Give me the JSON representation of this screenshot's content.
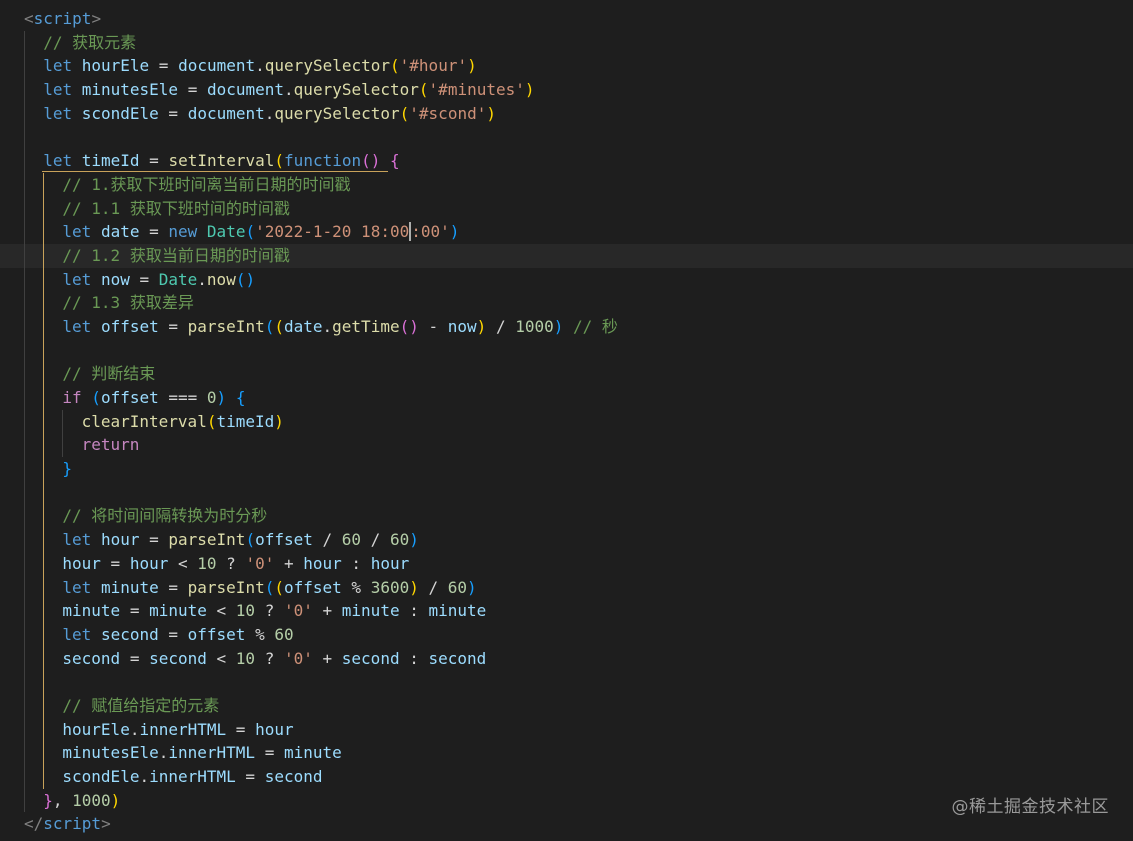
{
  "editor": {
    "theme_colors": {
      "background": "#1e1e1e",
      "comment": "#6a9955",
      "keyword": "#569cd6",
      "variable": "#9cdcfe",
      "function": "#dcdcaa",
      "string": "#ce9178",
      "number": "#b5cea8",
      "class": "#4ec9b0",
      "control": "#c586c0"
    },
    "cursor_line": 10,
    "lines": [
      {
        "indent": 0,
        "tokens": [
          [
            "tag",
            "<"
          ],
          [
            "tagname",
            "script"
          ],
          [
            "tag",
            ">"
          ]
        ]
      },
      {
        "indent": 1,
        "tokens": [
          [
            "comment",
            "// 获取元素"
          ]
        ]
      },
      {
        "indent": 1,
        "tokens": [
          [
            "kw",
            "let"
          ],
          [
            "plain",
            " "
          ],
          [
            "var",
            "hourEle"
          ],
          [
            "op",
            " = "
          ],
          [
            "var",
            "document"
          ],
          [
            "punc",
            "."
          ],
          [
            "fn",
            "querySelector"
          ],
          [
            "b1",
            "("
          ],
          [
            "str",
            "'#hour'"
          ],
          [
            "b1",
            ")"
          ]
        ]
      },
      {
        "indent": 1,
        "tokens": [
          [
            "kw",
            "let"
          ],
          [
            "plain",
            " "
          ],
          [
            "var",
            "minutesEle"
          ],
          [
            "op",
            " = "
          ],
          [
            "var",
            "document"
          ],
          [
            "punc",
            "."
          ],
          [
            "fn",
            "querySelector"
          ],
          [
            "b1",
            "("
          ],
          [
            "str",
            "'#minutes'"
          ],
          [
            "b1",
            ")"
          ]
        ]
      },
      {
        "indent": 1,
        "tokens": [
          [
            "kw",
            "let"
          ],
          [
            "plain",
            " "
          ],
          [
            "var",
            "scondEle"
          ],
          [
            "op",
            " = "
          ],
          [
            "var",
            "document"
          ],
          [
            "punc",
            "."
          ],
          [
            "fn",
            "querySelector"
          ],
          [
            "b1",
            "("
          ],
          [
            "str",
            "'#scond'"
          ],
          [
            "b1",
            ")"
          ]
        ]
      },
      {
        "indent": 1,
        "tokens": []
      },
      {
        "indent": 1,
        "tokens": [
          [
            "kw",
            "let"
          ],
          [
            "plain",
            " "
          ],
          [
            "var",
            "timeId"
          ],
          [
            "op",
            " = "
          ],
          [
            "fn",
            "setInterval"
          ],
          [
            "b1",
            "("
          ],
          [
            "kw",
            "function"
          ],
          [
            "b2",
            "()"
          ],
          [
            "plain",
            " "
          ],
          [
            "b2",
            "{"
          ]
        ]
      },
      {
        "indent": 2,
        "tokens": [
          [
            "comment",
            "// 1.获取下班时间离当前日期的时间戳"
          ]
        ]
      },
      {
        "indent": 2,
        "tokens": [
          [
            "comment",
            "// 1.1 获取下班时间的时间戳"
          ]
        ]
      },
      {
        "indent": 2,
        "tokens": [
          [
            "kw",
            "let"
          ],
          [
            "plain",
            " "
          ],
          [
            "var",
            "date"
          ],
          [
            "op",
            " = "
          ],
          [
            "kw",
            "new"
          ],
          [
            "plain",
            " "
          ],
          [
            "cls",
            "Date"
          ],
          [
            "b3",
            "("
          ],
          [
            "str",
            "'2022-1-20 18:00"
          ],
          [
            "caret",
            ""
          ],
          [
            "str",
            ":00'"
          ],
          [
            "b3",
            ")"
          ]
        ]
      },
      {
        "indent": 2,
        "tokens": [
          [
            "comment",
            "// 1.2 获取当前日期的时间戳"
          ]
        ]
      },
      {
        "indent": 2,
        "tokens": [
          [
            "kw",
            "let"
          ],
          [
            "plain",
            " "
          ],
          [
            "var",
            "now"
          ],
          [
            "op",
            " = "
          ],
          [
            "cls",
            "Date"
          ],
          [
            "punc",
            "."
          ],
          [
            "fn",
            "now"
          ],
          [
            "b3",
            "()"
          ]
        ]
      },
      {
        "indent": 2,
        "tokens": [
          [
            "comment",
            "// 1.3 获取差异"
          ]
        ]
      },
      {
        "indent": 2,
        "tokens": [
          [
            "kw",
            "let"
          ],
          [
            "plain",
            " "
          ],
          [
            "var",
            "offset"
          ],
          [
            "op",
            " = "
          ],
          [
            "fn",
            "parseInt"
          ],
          [
            "b3",
            "("
          ],
          [
            "b1",
            "("
          ],
          [
            "var",
            "date"
          ],
          [
            "punc",
            "."
          ],
          [
            "fn",
            "getTime"
          ],
          [
            "b2",
            "()"
          ],
          [
            "op",
            " - "
          ],
          [
            "var",
            "now"
          ],
          [
            "b1",
            ")"
          ],
          [
            "op",
            " / "
          ],
          [
            "num",
            "1000"
          ],
          [
            "b3",
            ")"
          ],
          [
            "plain",
            " "
          ],
          [
            "comment",
            "// 秒"
          ]
        ]
      },
      {
        "indent": 2,
        "tokens": []
      },
      {
        "indent": 2,
        "tokens": [
          [
            "comment",
            "// 判断结束"
          ]
        ]
      },
      {
        "indent": 2,
        "tokens": [
          [
            "ctl",
            "if"
          ],
          [
            "plain",
            " "
          ],
          [
            "b3",
            "("
          ],
          [
            "var",
            "offset"
          ],
          [
            "op",
            " === "
          ],
          [
            "num",
            "0"
          ],
          [
            "b3",
            ")"
          ],
          [
            "plain",
            " "
          ],
          [
            "b3",
            "{"
          ]
        ]
      },
      {
        "indent": 3,
        "tokens": [
          [
            "fn",
            "clearInterval"
          ],
          [
            "b1",
            "("
          ],
          [
            "var",
            "timeId"
          ],
          [
            "b1",
            ")"
          ]
        ]
      },
      {
        "indent": 3,
        "tokens": [
          [
            "ctl",
            "return"
          ]
        ]
      },
      {
        "indent": 2,
        "tokens": [
          [
            "b3",
            "}"
          ]
        ]
      },
      {
        "indent": 2,
        "tokens": []
      },
      {
        "indent": 2,
        "tokens": [
          [
            "comment",
            "// 将时间间隔转换为时分秒"
          ]
        ]
      },
      {
        "indent": 2,
        "tokens": [
          [
            "kw",
            "let"
          ],
          [
            "plain",
            " "
          ],
          [
            "var",
            "hour"
          ],
          [
            "op",
            " = "
          ],
          [
            "fn",
            "parseInt"
          ],
          [
            "b3",
            "("
          ],
          [
            "var",
            "offset"
          ],
          [
            "op",
            " / "
          ],
          [
            "num",
            "60"
          ],
          [
            "op",
            " / "
          ],
          [
            "num",
            "60"
          ],
          [
            "b3",
            ")"
          ]
        ]
      },
      {
        "indent": 2,
        "tokens": [
          [
            "var",
            "hour"
          ],
          [
            "op",
            " = "
          ],
          [
            "var",
            "hour"
          ],
          [
            "op",
            " < "
          ],
          [
            "num",
            "10"
          ],
          [
            "op",
            " ? "
          ],
          [
            "str",
            "'0'"
          ],
          [
            "op",
            " + "
          ],
          [
            "var",
            "hour"
          ],
          [
            "op",
            " : "
          ],
          [
            "var",
            "hour"
          ]
        ]
      },
      {
        "indent": 2,
        "tokens": [
          [
            "kw",
            "let"
          ],
          [
            "plain",
            " "
          ],
          [
            "var",
            "minute"
          ],
          [
            "op",
            " = "
          ],
          [
            "fn",
            "parseInt"
          ],
          [
            "b3",
            "("
          ],
          [
            "b1",
            "("
          ],
          [
            "var",
            "offset"
          ],
          [
            "op",
            " % "
          ],
          [
            "num",
            "3600"
          ],
          [
            "b1",
            ")"
          ],
          [
            "op",
            " / "
          ],
          [
            "num",
            "60"
          ],
          [
            "b3",
            ")"
          ]
        ]
      },
      {
        "indent": 2,
        "tokens": [
          [
            "var",
            "minute"
          ],
          [
            "op",
            " = "
          ],
          [
            "var",
            "minute"
          ],
          [
            "op",
            " < "
          ],
          [
            "num",
            "10"
          ],
          [
            "op",
            " ? "
          ],
          [
            "str",
            "'0'"
          ],
          [
            "op",
            " + "
          ],
          [
            "var",
            "minute"
          ],
          [
            "op",
            " : "
          ],
          [
            "var",
            "minute"
          ]
        ]
      },
      {
        "indent": 2,
        "tokens": [
          [
            "kw",
            "let"
          ],
          [
            "plain",
            " "
          ],
          [
            "var",
            "second"
          ],
          [
            "op",
            " = "
          ],
          [
            "var",
            "offset"
          ],
          [
            "op",
            " % "
          ],
          [
            "num",
            "60"
          ]
        ]
      },
      {
        "indent": 2,
        "tokens": [
          [
            "var",
            "second"
          ],
          [
            "op",
            " = "
          ],
          [
            "var",
            "second"
          ],
          [
            "op",
            " < "
          ],
          [
            "num",
            "10"
          ],
          [
            "op",
            " ? "
          ],
          [
            "str",
            "'0'"
          ],
          [
            "op",
            " + "
          ],
          [
            "var",
            "second"
          ],
          [
            "op",
            " : "
          ],
          [
            "var",
            "second"
          ]
        ]
      },
      {
        "indent": 2,
        "tokens": []
      },
      {
        "indent": 2,
        "tokens": [
          [
            "comment",
            "// 赋值给指定的元素"
          ]
        ]
      },
      {
        "indent": 2,
        "tokens": [
          [
            "var",
            "hourEle"
          ],
          [
            "punc",
            "."
          ],
          [
            "var",
            "innerHTML"
          ],
          [
            "op",
            " = "
          ],
          [
            "var",
            "hour"
          ]
        ]
      },
      {
        "indent": 2,
        "tokens": [
          [
            "var",
            "minutesEle"
          ],
          [
            "punc",
            "."
          ],
          [
            "var",
            "innerHTML"
          ],
          [
            "op",
            " = "
          ],
          [
            "var",
            "minute"
          ]
        ]
      },
      {
        "indent": 2,
        "tokens": [
          [
            "var",
            "scondEle"
          ],
          [
            "punc",
            "."
          ],
          [
            "var",
            "innerHTML"
          ],
          [
            "op",
            " = "
          ],
          [
            "var",
            "second"
          ]
        ]
      },
      {
        "indent": 1,
        "tokens": [
          [
            "b2",
            "}"
          ],
          [
            "punc",
            ", "
          ],
          [
            "num",
            "1000"
          ],
          [
            "b1",
            ")"
          ]
        ]
      },
      {
        "indent": 0,
        "tokens": [
          [
            "tag",
            "</"
          ],
          [
            "tagname",
            "script"
          ],
          [
            "tag",
            ">"
          ]
        ]
      }
    ]
  },
  "watermark": "@稀土掘金技术社区"
}
